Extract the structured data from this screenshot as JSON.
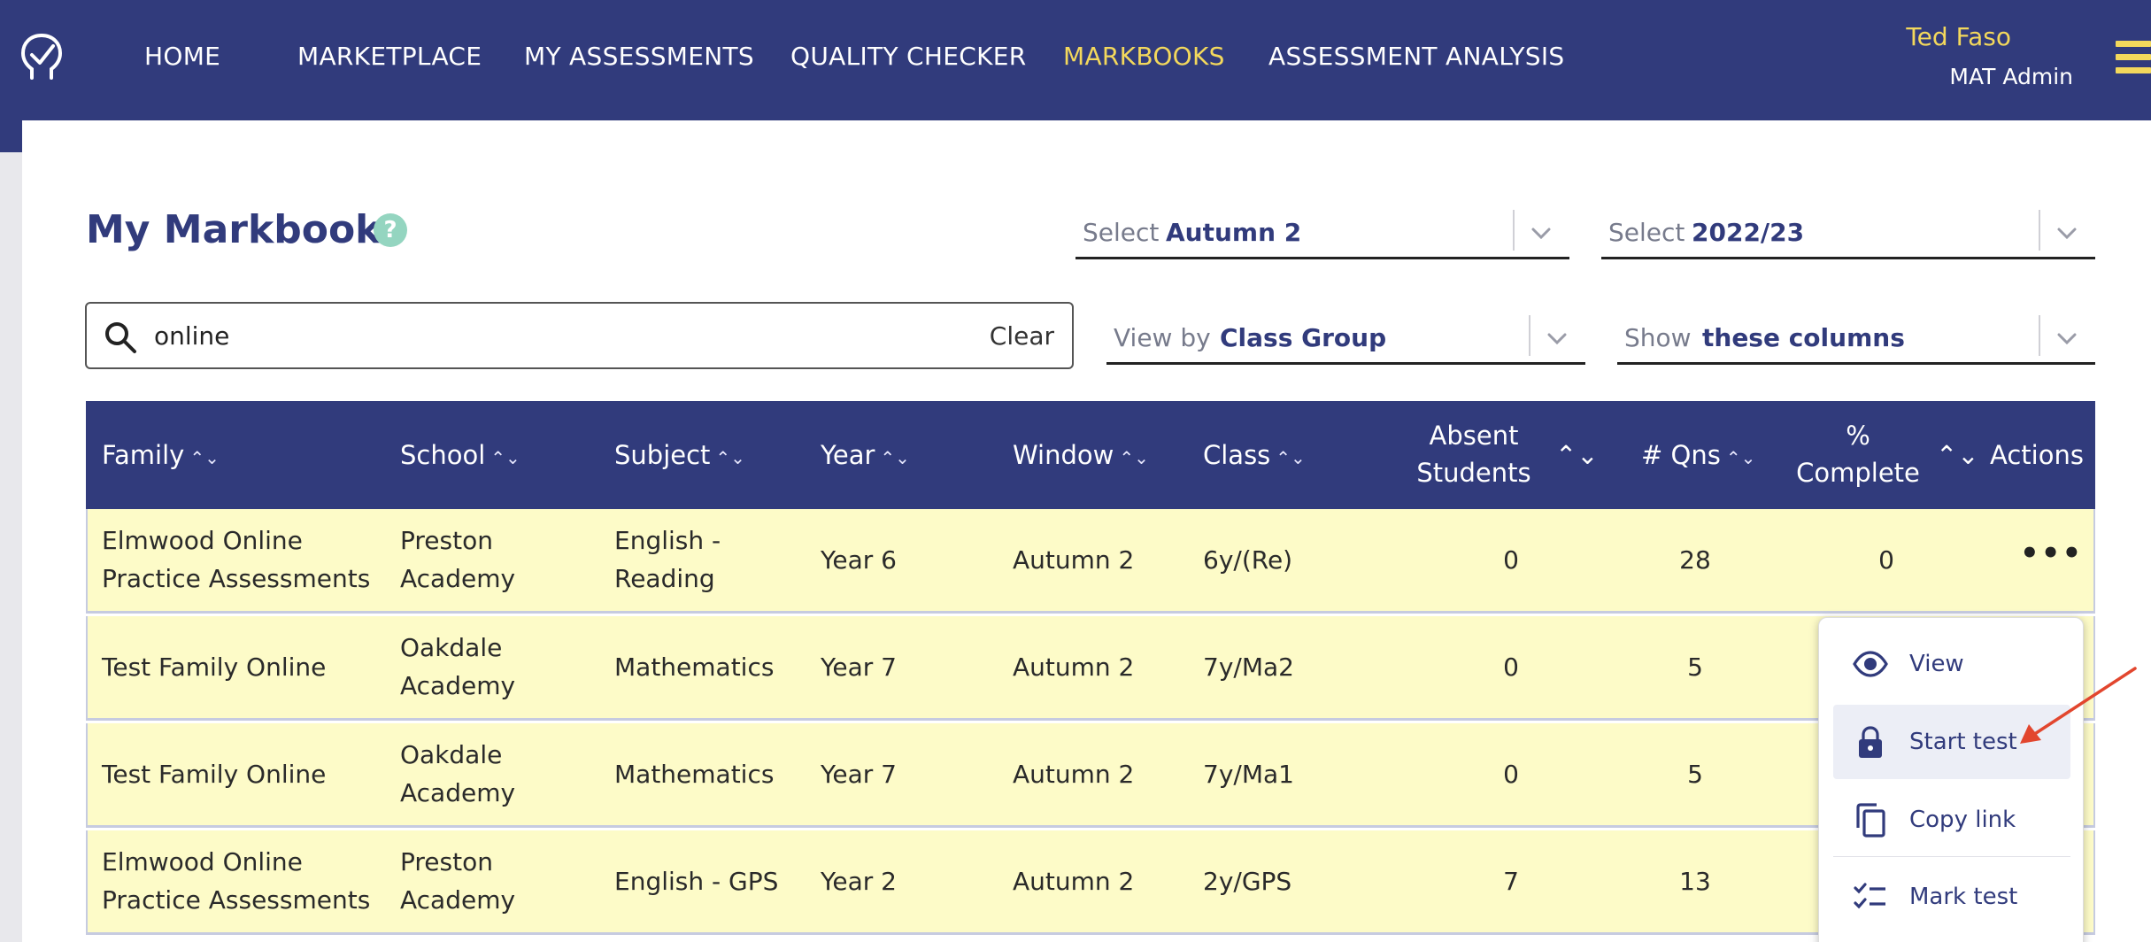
{
  "nav": {
    "links": [
      "HOME",
      "MARKETPLACE",
      "MY ASSESSMENTS",
      "QUALITY CHECKER",
      "MARKBOOKS",
      "ASSESSMENT ANALYSIS"
    ],
    "active": "MARKBOOKS",
    "user_name": "Ted Faso",
    "user_role": "MAT Admin"
  },
  "page": {
    "title": "My Markbooks",
    "help": "?"
  },
  "filters": {
    "window": {
      "label": "Select",
      "value": "Autumn 2"
    },
    "year": {
      "label": "Select",
      "value": "2022/23"
    },
    "view_by": {
      "label": "View by",
      "value": "Class Group"
    },
    "show": {
      "label": "Show",
      "value": "these columns"
    }
  },
  "search": {
    "value": "online",
    "clear_label": "Clear"
  },
  "table": {
    "headers": {
      "family": "Family",
      "school": "School",
      "subject": "Subject",
      "year": "Year",
      "window": "Window",
      "class": "Class",
      "absent_1": "Absent",
      "absent_2": "Students",
      "qns": "# Qns",
      "complete_1": "%",
      "complete_2": "Complete",
      "actions": "Actions"
    },
    "sort_glyph": "⌃⌄",
    "rows": [
      {
        "family": [
          "Elmwood Online",
          "Practice Assessments"
        ],
        "school": [
          "Preston",
          "Academy"
        ],
        "subject": [
          "English -",
          "Reading"
        ],
        "year": "Year 6",
        "window": "Autumn 2",
        "class": "6y/(Re)",
        "absent": "0",
        "qns": "28",
        "complete": "0"
      },
      {
        "family": [
          "Test Family Online"
        ],
        "school": [
          "Oakdale",
          "Academy"
        ],
        "subject": [
          "Mathematics"
        ],
        "year": "Year 7",
        "window": "Autumn 2",
        "class": "7y/Ma2",
        "absent": "0",
        "qns": "5",
        "complete": ""
      },
      {
        "family": [
          "Test Family Online"
        ],
        "school": [
          "Oakdale",
          "Academy"
        ],
        "subject": [
          "Mathematics"
        ],
        "year": "Year 7",
        "window": "Autumn 2",
        "class": "7y/Ma1",
        "absent": "0",
        "qns": "5",
        "complete": ""
      },
      {
        "family": [
          "Elmwood Online",
          "Practice Assessments"
        ],
        "school": [
          "Preston",
          "Academy"
        ],
        "subject": [
          "English - GPS"
        ],
        "year": "Year 2",
        "window": "Autumn 2",
        "class": "2y/GPS",
        "absent": "7",
        "qns": "13",
        "complete": ""
      }
    ],
    "actions_glyph": "•••"
  },
  "menu": {
    "items": [
      {
        "label": "View",
        "icon": "eye-icon"
      },
      {
        "label": "Start test",
        "icon": "lock-icon"
      },
      {
        "label": "Copy link",
        "icon": "copy-icon"
      },
      {
        "label": "Mark test",
        "icon": "checklist-icon"
      }
    ]
  },
  "colors": {
    "nav_bg": "#313b7c",
    "accent_yellow": "#f3d85c",
    "row_bg": "#fdfbc8",
    "help_green": "#94d5c0",
    "annotation_arrow": "#e2462e"
  }
}
